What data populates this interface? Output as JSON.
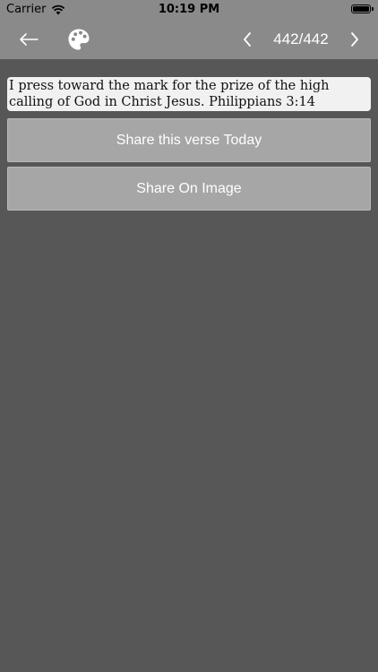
{
  "status_bar": {
    "carrier": "Carrier",
    "time": "10:19 PM"
  },
  "nav": {
    "back_icon": "arrow-left-icon",
    "palette_icon": "palette-icon",
    "prev_icon": "chevron-left-icon",
    "next_icon": "chevron-right-icon",
    "counter": "442/442"
  },
  "verse": {
    "text": "I press toward the mark for the prize of the high calling of God in Christ Jesus. Philippians 3:14"
  },
  "actions": {
    "share_today_label": "Share this verse Today",
    "share_image_label": "Share On Image"
  },
  "colors": {
    "background": "#575757",
    "bar": "#8a8a8a",
    "button": "#a6a6a6",
    "verse_bg": "#f1f1f1"
  }
}
